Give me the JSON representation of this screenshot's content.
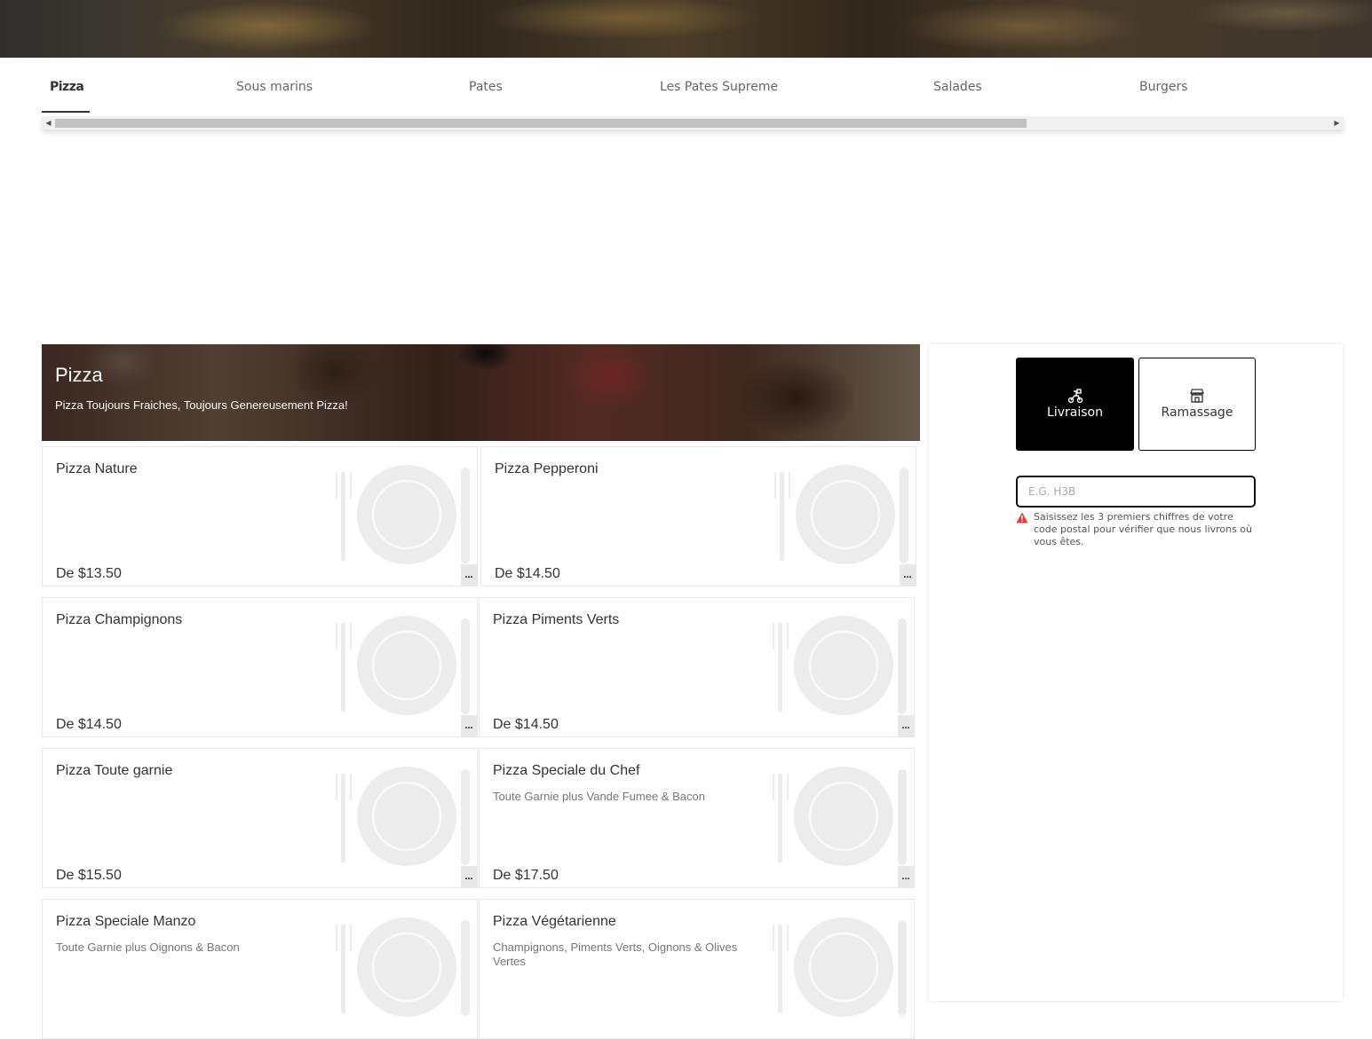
{
  "tabs": [
    {
      "label": "Pizza",
      "active": true
    },
    {
      "label": "Sous marins"
    },
    {
      "label": "Pates"
    },
    {
      "label": "Les Pates Supreme"
    },
    {
      "label": "Salades"
    },
    {
      "label": "Burgers"
    }
  ],
  "category": {
    "title": "Pizza",
    "subtitle": "Pizza Toujours Fraiches, Toujours Genereusement Pizza!"
  },
  "items": [
    {
      "name": "Pizza Nature",
      "description": "",
      "price": "De $13.50",
      "more": "..."
    },
    {
      "name": "Pizza Pepperoni",
      "description": "",
      "price": "De $14.50",
      "more": "..."
    },
    {
      "name": "Pizza Champignons",
      "description": "",
      "price": "De $14.50",
      "more": "..."
    },
    {
      "name": "Pizza Piments Verts",
      "description": "",
      "price": "De $14.50",
      "more": "..."
    },
    {
      "name": "Pizza Toute garnie",
      "description": "",
      "price": "De $15.50",
      "more": "..."
    },
    {
      "name": "Pizza Speciale du Chef",
      "description": "Toute Garnie plus Vande Fumee & Bacon",
      "price": "De $17.50",
      "more": "..."
    },
    {
      "name": "Pizza Speciale Manzo",
      "description": "Toute Garnie plus Oignons & Bacon",
      "price": "",
      "more": ""
    },
    {
      "name": "Pizza Végétarienne",
      "description": "Champignons, Piments Verts, Oignons & Olives Vertes",
      "price": "",
      "more": ""
    }
  ],
  "order": {
    "delivery_label": "Livraison",
    "pickup_label": "Ramassage",
    "selected_mode": "Livraison",
    "postal_placeholder": "E.G. H3B",
    "postal_value": "",
    "postal_hint": "Saisissez les 3 premiers chiffres de votre code postal pour vérifier que nous livrons où vous êtes."
  },
  "colors": {
    "accent": "#000000",
    "warning": "#e03b3b"
  }
}
